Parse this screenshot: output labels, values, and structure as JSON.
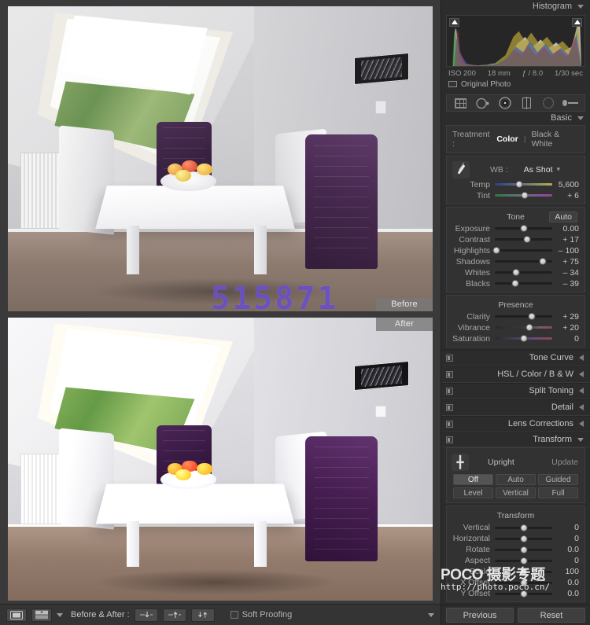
{
  "image_view": {
    "before_label": "Before",
    "after_label": "After",
    "watermark_number": "515871"
  },
  "left_toolbar": {
    "loupe_icon": "loupe-view-icon",
    "split_icon": "before-after-split-icon",
    "before_after_label": "Before & After :",
    "copy_buttons": [
      "copy-settings-down",
      "copy-settings-up",
      "swap-settings"
    ],
    "soft_proofing_label": "Soft Proofing",
    "soft_proofing_checked": false
  },
  "histogram": {
    "title": "Histogram",
    "shadow_clip_icon": "shadow-clipping-icon",
    "highlight_clip_icon": "highlight-clipping-icon",
    "exif": {
      "iso": "ISO 200",
      "focal_length": "18 mm",
      "aperture": "ƒ / 8.0",
      "shutter": "1/30 sec"
    },
    "original_photo_label": "Original Photo"
  },
  "tool_strip": {
    "tools": [
      {
        "name": "crop-overlay-icon"
      },
      {
        "name": "spot-removal-icon"
      },
      {
        "name": "red-eye-correction-icon"
      },
      {
        "name": "graduated-filter-icon"
      },
      {
        "name": "radial-filter-icon"
      },
      {
        "name": "adjustment-brush-icon"
      }
    ]
  },
  "basic": {
    "title": "Basic",
    "treatment_label": "Treatment :",
    "treatment_options": [
      "Color",
      "Black & White"
    ],
    "treatment_selected": "Color",
    "wb_label": "WB :",
    "wb_value": "As Shot",
    "wb_sliders": [
      {
        "name": "Temp",
        "value": "5,600",
        "pos": 42,
        "grad": "grad-temp"
      },
      {
        "name": "Tint",
        "value": "+ 6",
        "pos": 52,
        "grad": "grad-tint"
      }
    ],
    "tone_header": "Tone",
    "auto_label": "Auto",
    "tone_sliders": [
      {
        "name": "Exposure",
        "value": "0.00",
        "pos": 50
      },
      {
        "name": "Contrast",
        "value": "+ 17",
        "pos": 56
      },
      {
        "name": "Highlights",
        "value": "– 100",
        "pos": 3
      },
      {
        "name": "Shadows",
        "value": "+ 75",
        "pos": 84
      },
      {
        "name": "Whites",
        "value": "– 34",
        "pos": 37
      },
      {
        "name": "Blacks",
        "value": "– 39",
        "pos": 36
      }
    ],
    "presence_header": "Presence",
    "presence_sliders": [
      {
        "name": "Clarity",
        "value": "+ 29",
        "pos": 64,
        "grad": ""
      },
      {
        "name": "Vibrance",
        "value": "+ 20",
        "pos": 60,
        "grad": "grad-vib"
      },
      {
        "name": "Saturation",
        "value": "0",
        "pos": 50,
        "grad": "grad-sat"
      }
    ]
  },
  "collapsed_panels": [
    {
      "title": "Tone Curve",
      "sub": ""
    },
    {
      "title": "HSL / Color / B & W",
      "sub": ""
    },
    {
      "title": "Split Toning",
      "sub": ""
    },
    {
      "title": "Detail",
      "sub": ""
    },
    {
      "title": "Lens Corrections",
      "sub": ""
    }
  ],
  "transform": {
    "title": "Transform",
    "upright_label": "Upright",
    "update_label": "Update",
    "upright_icon": "upright-crosshair-icon",
    "upright_buttons_row1": [
      "Off",
      "Auto",
      "Guided"
    ],
    "upright_buttons_row2": [
      "Level",
      "Vertical",
      "Full"
    ],
    "upright_selected": "Off",
    "section_header": "Transform",
    "sliders": [
      {
        "name": "Vertical",
        "value": "0",
        "pos": 50
      },
      {
        "name": "Horizontal",
        "value": "0",
        "pos": 50
      },
      {
        "name": "Rotate",
        "value": "0.0",
        "pos": 50
      },
      {
        "name": "Aspect",
        "value": "0",
        "pos": 50
      },
      {
        "name": "Scale",
        "value": "100",
        "pos": 50
      },
      {
        "name": "X Offset",
        "value": "0.0",
        "pos": 50
      },
      {
        "name": "Y Offset",
        "value": "0.0",
        "pos": 50
      }
    ]
  },
  "watermark": {
    "main": "POCO 摄影专题",
    "url": "http://photo.poco.cn/"
  },
  "right_bottom": {
    "previous_label": "Previous",
    "reset_label": "Reset"
  },
  "colors": {
    "panel_bg": "#2c2c2c",
    "accent": "#6a50c8"
  }
}
